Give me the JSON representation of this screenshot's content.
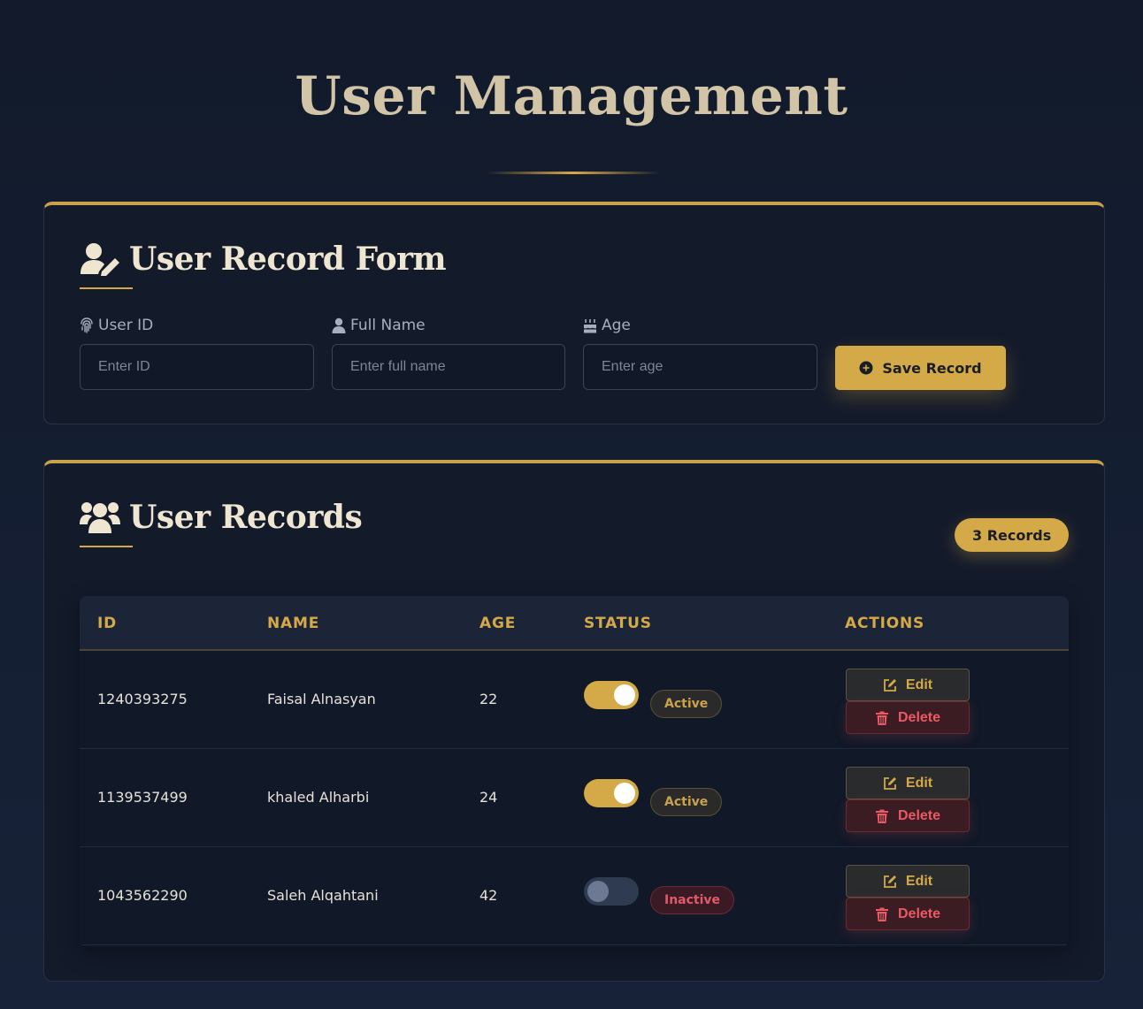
{
  "header": {
    "title": "User Management"
  },
  "form": {
    "title": "User Record Form",
    "fields": [
      {
        "label": "User ID",
        "placeholder": "Enter ID",
        "value": "",
        "icon": "fingerprint-icon"
      },
      {
        "label": "Full Name",
        "placeholder": "Enter full name",
        "value": "",
        "icon": "user-icon"
      },
      {
        "label": "Age",
        "placeholder": "Enter age",
        "value": "",
        "icon": "birthday-cake-icon"
      }
    ],
    "save_label": "Save Record",
    "save_icon": "plus-circle-icon"
  },
  "records": {
    "title": "User Records",
    "count_label": "3 Records",
    "columns": [
      "ID",
      "NAME",
      "AGE",
      "STATUS",
      "ACTIONS"
    ],
    "rows": [
      {
        "id": "1240393275",
        "name": "Faisal Alnasyan",
        "age": "22",
        "status": "Active",
        "active": true,
        "edit_label": "Edit",
        "delete_label": "Delete"
      },
      {
        "id": "1139537499",
        "name": "khaled Alharbi",
        "age": "24",
        "status": "Active",
        "active": true,
        "edit_label": "Edit",
        "delete_label": "Delete"
      },
      {
        "id": "1043562290",
        "name": "Saleh Alqahtani",
        "age": "42",
        "status": "Inactive",
        "active": false,
        "edit_label": "Edit",
        "delete_label": "Delete"
      }
    ]
  },
  "colors": {
    "accent": "#d4a948",
    "background": "#131a2a",
    "danger": "#ea5a64"
  }
}
